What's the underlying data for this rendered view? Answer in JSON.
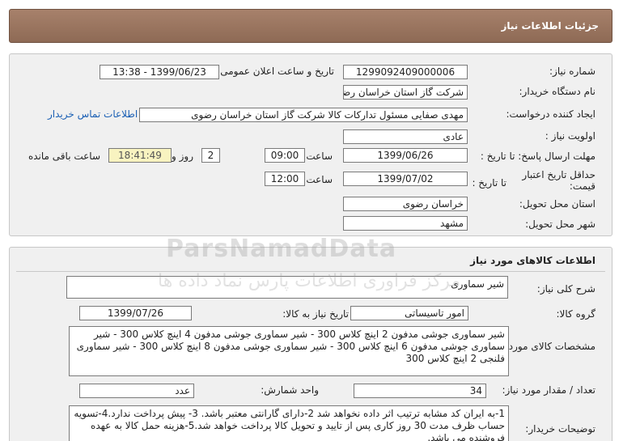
{
  "header": {
    "title": "جزئیات اطلاعات نیاز"
  },
  "need_info": {
    "need_number_label": "شماره نیاز:",
    "need_number": "1299092409000006",
    "announce_label": "تاریخ و ساعت اعلان عمومی:",
    "announce_value": "1399/06/23 - 13:38",
    "buyer_org_label": "نام دستگاه خریدار:",
    "buyer_org": "شرکت گاز استان خراسان رضوی",
    "requester_label": "ایجاد کننده درخواست:",
    "requester": "مهدی صفایی مسئول تدارکات کالا شرکت گاز استان خراسان رضوی",
    "contact_link": "اطلاعات تماس خریدار",
    "priority_label": "اولویت نیاز :",
    "priority": "عادی",
    "reply_deadline_label": "مهلت ارسال پاسخ: تا تاریخ :",
    "reply_date": "1399/06/26",
    "time_label": "ساعت",
    "reply_time": "09:00",
    "days_value": "2",
    "days_label": "روز و",
    "remaining_time": "18:41:49",
    "remaining_label": "ساعت باقی مانده",
    "validity_label": "حداقل تاریخ اعتبار قیمت:",
    "validity_to_label": "تا تاریخ :",
    "validity_date": "1399/07/02",
    "validity_time": "12:00",
    "province_label": "استان محل تحویل:",
    "province": "خراسان رضوی",
    "city_label": "شهر محل تحویل:",
    "city": "مشهد"
  },
  "goods": {
    "title": "اطلاعات کالاهای مورد نیاز",
    "summary_label": "شرح کلی نیاز:",
    "summary": "شیر سماوری",
    "group_label": "گروه کالا:",
    "group": "امور تاسیساتی",
    "need_date_label": "تاریخ نیاز به کالا:",
    "need_date": "1399/07/26",
    "specs_label": "مشخصات کالای مورد نیاز:",
    "specs": "شیر سماوری جوشی مدفون 2 اینچ کلاس 300 - شیر سماوری جوشی مدفون 4 اینچ کلاس 300 - شیر سماوری جوشی مدفون 6 اینچ کلاس 300 - شیر سماوری جوشی مدفون 8 اینچ کلاس 300 - شیر سماوری فلنجی 2 اینچ کلاس 300",
    "qty_label": "تعداد / مقدار مورد نیاز:",
    "qty": "34",
    "unit_label": "واحد شمارش:",
    "unit": "عدد",
    "notes_label": "توضیحات خریدار:",
    "notes": "1-به ایران کد مشابه ترتیب اثر داده نخواهد شد 2-دارای گارانتی معتبر باشد. 3- پیش پرداخت ندارد.4-تسویه حساب ظرف مدت 30 روز کاری پس از تایید و تحویل کالا پرداخت خواهد شد.5-هزینه حمل کالا به عهده فروشنده می باشد."
  },
  "watermark": {
    "latin": "ParsNamadData",
    "persian": "مرکز فراوری اطلاعات پارس نماد داده ها"
  }
}
